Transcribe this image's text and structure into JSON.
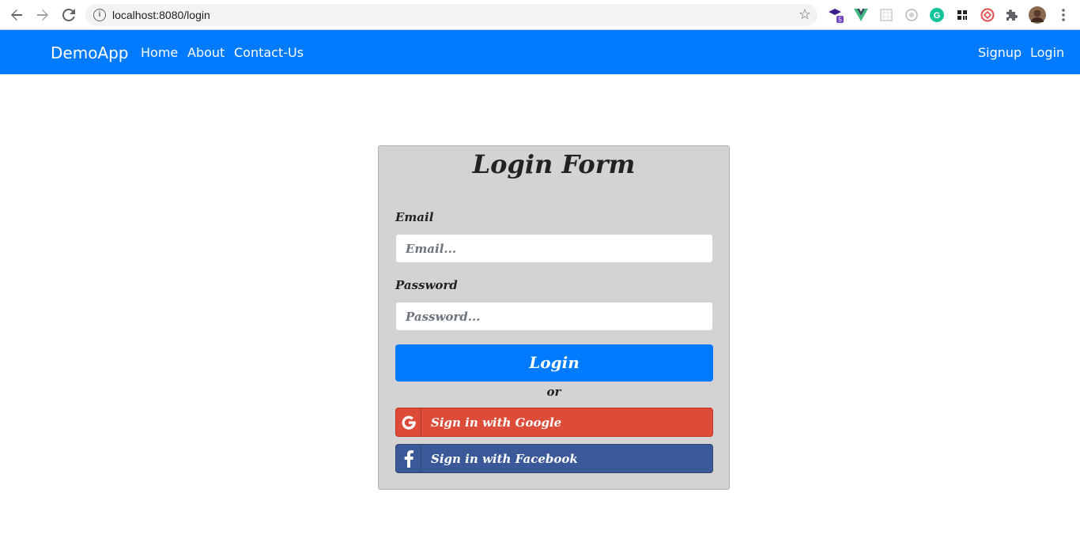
{
  "browser": {
    "url": "localhost:8080/login",
    "extension_badge": "5",
    "icons": [
      "back-arrow-icon",
      "forward-arrow-icon",
      "reload-icon",
      "info-icon",
      "star-icon",
      "puzzle-icon",
      "menu-dots-icon"
    ]
  },
  "navbar": {
    "brand": "DemoApp",
    "links": [
      "Home",
      "About",
      "Contact-Us"
    ],
    "right_links": [
      "Signup",
      "Login"
    ],
    "color": "#007bff"
  },
  "form": {
    "title": "Login Form",
    "email_label": "Email",
    "email_placeholder": "Email...",
    "password_label": "Password",
    "password_placeholder": "Password...",
    "login_button": "Login",
    "or_text": "or",
    "google_button": "Sign in with Google",
    "facebook_button": "Sign in with Facebook",
    "colors": {
      "card": "#d3d3d3",
      "google": "#dd4b39",
      "facebook": "#3b5998"
    }
  }
}
